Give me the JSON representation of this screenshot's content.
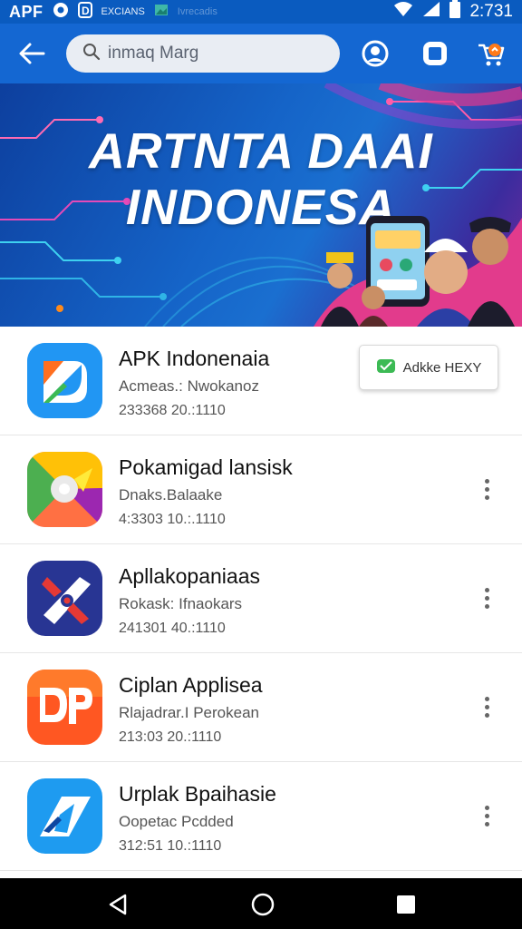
{
  "status_bar": {
    "app_label": "APF",
    "small_text": "EXCIANS",
    "muted_text": "Ivrecadis",
    "time": "2:731"
  },
  "app_bar": {
    "search_placeholder": "inmaq Marg",
    "icons": [
      "back-arrow-icon",
      "search-icon",
      "account-icon",
      "window-icon",
      "cart-icon"
    ]
  },
  "banner": {
    "title_line1": "ARTNTA DAAI",
    "title_line2": "INDONESA"
  },
  "apps": [
    {
      "name": "APK Indonenaia",
      "subtitle": "Acmeas.: Nwokanoz",
      "meta": "233368 20.:1110",
      "action": "button",
      "action_label": "Adkke HEXY",
      "icon": "apk-indonesia-icon",
      "colors": {
        "bg": "#2196f3",
        "accent": "#ff6f20",
        "green": "#3cba54"
      }
    },
    {
      "name": "Pokamigad lansisk",
      "subtitle": "Dnaks.Balaake",
      "meta": "4:3303 10.:.1110",
      "action": "more",
      "icon": "pokamigad-icon",
      "colors": {
        "bg": "#ff5a5f",
        "accent": "#ffc107",
        "green": "#4caf50"
      }
    },
    {
      "name": "Apllakopaniaas",
      "subtitle": "Rokask: Ifnaokars",
      "meta": "241301 40.:1110",
      "action": "more",
      "icon": "apllakopaniaas-icon",
      "colors": {
        "bg": "#283593",
        "accent": "#e53935",
        "green": "#ffffff"
      }
    },
    {
      "name": "Ciplan Applisea",
      "subtitle": "Rlajadrar.I Perokean",
      "meta": "213:03 20.:1110",
      "action": "more",
      "icon": "ciplan-icon",
      "colors": {
        "bg": "#ff5722",
        "accent": "#ffffff",
        "green": "#ff9800"
      }
    },
    {
      "name": "Urplak Bpaihasie",
      "subtitle": "Oopetac Pcdded",
      "meta": "312:51 10.:1110",
      "action": "more",
      "icon": "urplak-icon",
      "colors": {
        "bg": "#1e9bf0",
        "accent": "#ffffff",
        "green": "#0d47a1"
      }
    }
  ],
  "nav_bar": {
    "buttons": [
      "back-nav-icon",
      "home-nav-icon",
      "recents-nav-icon"
    ]
  },
  "colors": {
    "status_bar": "#0a5bbf",
    "app_bar": "#1467d2",
    "search_bg": "#e9edf3"
  }
}
